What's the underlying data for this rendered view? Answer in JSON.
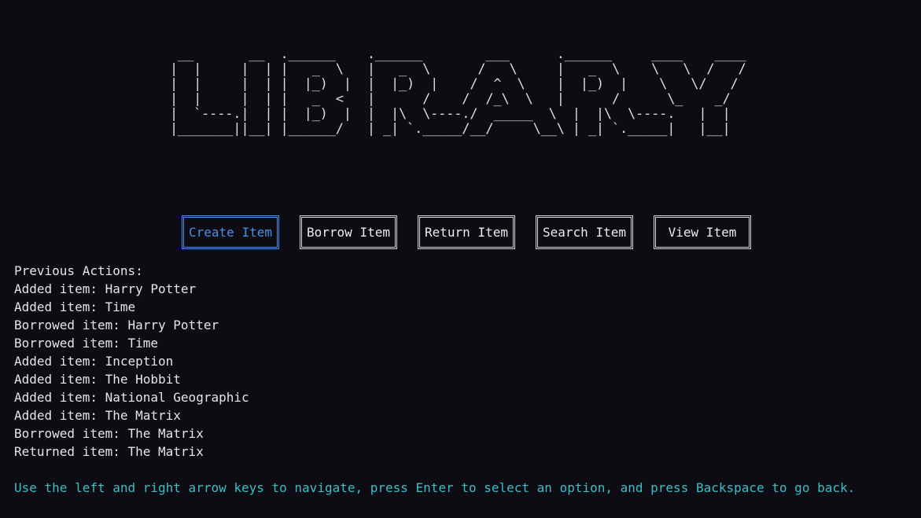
{
  "banner": {
    "ascii": " __       __  .______    .______        ___      .______     ____    ____ \n|  |     |  | |   _  \\   |   _  \\      /   \\     |   _  \\    \\   \\  /   / \n|  |     |  | |  |_)  |  |  |_)  |    /  ^  \\    |  |_)  |    \\   \\/   /  \n|  |     |  | |   _  <   |      /    /  /_\\  \\   |      /      \\_    _/   \n|  `----.|  | |  |_)  |  |  |\\  \\----./  _____  \\  |  |\\  \\----.   |  |     \n|_______||__| |______/   | _| `._____/__/     \\__\\ | _| `._____|   |__|     "
  },
  "menu": {
    "items": [
      {
        "label": "Create Item",
        "selected": true
      },
      {
        "label": "Borrow Item",
        "selected": false
      },
      {
        "label": "Return Item",
        "selected": false
      },
      {
        "label": "Search Item",
        "selected": false
      },
      {
        "label": "View Item",
        "selected": false
      }
    ]
  },
  "history": {
    "title": "Previous Actions:",
    "lines": [
      "Added item: Harry Potter",
      "Added item: Time",
      "Borrowed item: Harry Potter",
      "Borrowed item: Time",
      "Added item: Inception",
      "Added item: The Hobbit",
      "Added item: National Geographic",
      "Added item: The Matrix",
      "Borrowed item: The Matrix",
      "Returned item: The Matrix"
    ]
  },
  "hint": "Use the left and right arrow keys to navigate, press Enter to select an option, and press Backspace to go back.",
  "colors": {
    "background": "#0c0c12",
    "selected": "#4a8fe8",
    "hint": "#3dbdc8",
    "text": "#e6e6e6"
  }
}
